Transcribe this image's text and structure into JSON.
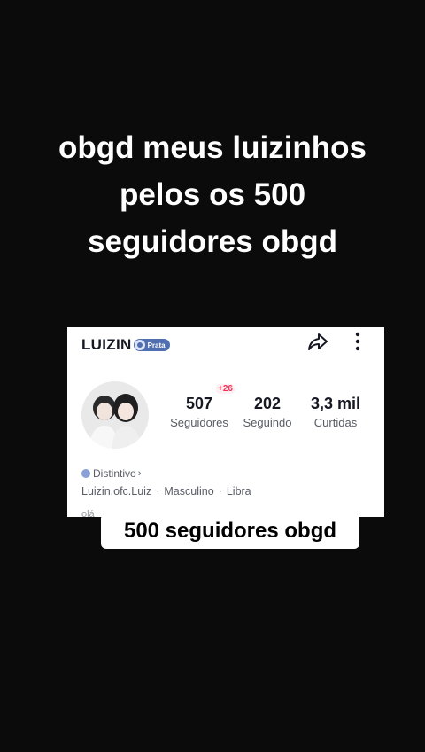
{
  "caption": {
    "lines": [
      "obgd meus luizinhos",
      "pelos os 500",
      "seguidores obgd"
    ]
  },
  "profile": {
    "username": "LUIZIN",
    "badge_label": "Prata",
    "stats": [
      {
        "value": "507",
        "label": "Seguidores"
      },
      {
        "value": "202",
        "label": "Seguindo"
      },
      {
        "value": "3,3 mil",
        "label": "Curtidas"
      }
    ],
    "followers_delta": "+26",
    "distintivo_label": "Distintivo",
    "meta": {
      "handle": "Luizin.ofc.Luiz",
      "gender": "Masculino",
      "sign": "Libra"
    },
    "cut_text": "olá"
  },
  "sticker": {
    "text": "500 seguidores obgd"
  }
}
